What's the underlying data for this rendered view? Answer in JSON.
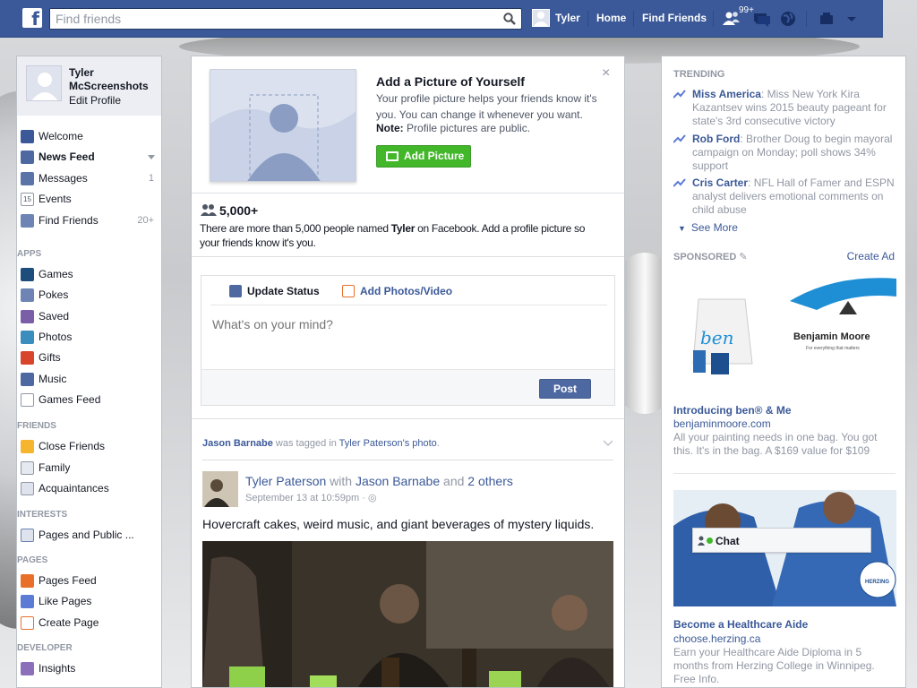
{
  "topbar": {
    "logo": "f",
    "search_placeholder": "Find friends",
    "user_name": "Tyler",
    "home": "Home",
    "find_friends": "Find Friends",
    "friend_requests_badge": "99+"
  },
  "left": {
    "profile_name": "Tyler McScreenshots",
    "edit_profile": "Edit Profile",
    "favorites": [
      {
        "label": "Welcome",
        "count": ""
      },
      {
        "label": "News Feed",
        "count": ""
      },
      {
        "label": "Messages",
        "count": "1"
      },
      {
        "label": "Events",
        "count": ""
      },
      {
        "label": "Find Friends",
        "count": "20+"
      }
    ],
    "apps_title": "APPS",
    "apps": [
      "Games",
      "Pokes",
      "Saved",
      "Photos",
      "Gifts",
      "Music",
      "Games Feed"
    ],
    "friends_title": "FRIENDS",
    "friends": [
      "Close Friends",
      "Family",
      "Acquaintances"
    ],
    "interests_title": "INTERESTS",
    "interests": [
      "Pages and Public ..."
    ],
    "pages_title": "PAGES",
    "pages": [
      "Pages Feed",
      "Like Pages",
      "Create Page"
    ],
    "developer_title": "DEVELOPER",
    "developer": [
      "Insights"
    ]
  },
  "center": {
    "add_pic_title": "Add a Picture of Yourself",
    "add_pic_text": "Your profile picture helps your friends know it's you. You can change it whenever you want.",
    "note_label": "Note:",
    "note_text": "Profile pictures are public.",
    "add_pic_button": "Add Picture",
    "close": "×",
    "people_count": "5,000+",
    "people_text_1": "There are more than 5,000 people named ",
    "people_name": "Tyler",
    "people_text_2": " on Facebook. Add a profile picture so your friends know it's you.",
    "composer": {
      "update_status": "Update Status",
      "add_photos": "Add Photos/Video",
      "placeholder": "What's on your mind?",
      "post": "Post"
    },
    "story": {
      "tagged_person": "Jason Barnabe",
      "tagged_text": " was tagged in ",
      "photo_owner": "Tyler Paterson's",
      "photo_word": "photo",
      "period": ".",
      "author": "Tyler Paterson",
      "with": " with ",
      "with_person": "Jason Barnabe",
      "and": " and ",
      "others": "2 others",
      "time": "September 13 at 10:59pm · ",
      "body": "Hovercraft cakes, weird music, and giant beverages of mystery liquids."
    }
  },
  "right": {
    "trending_title": "TRENDING",
    "trends": [
      {
        "name": "Miss America",
        "text": ": Miss New York Kira Kazantsev wins 2015 beauty pageant for state's 3rd consecutive victory"
      },
      {
        "name": "Rob Ford",
        "text": ": Brother Doug to begin mayoral campaign on Monday; poll shows 34% support"
      },
      {
        "name": "Cris Carter",
        "text": ": NFL Hall of Famer and ESPN analyst delivers emotional comments on child abuse"
      }
    ],
    "see_more": "See More",
    "sponsored_title": "SPONSORED",
    "create_ad": "Create Ad",
    "ad1": {
      "brand_text": "Benjamin Moore",
      "brand_tagline": "For everything that matters",
      "bag_text": "ben",
      "title": "Introducing ben® & Me",
      "url": "benjaminmoore.com",
      "text": "All your painting needs in one bag. You got this. It's in the bag. A $169 value for $109"
    },
    "ad2": {
      "badge_text": "HERZING",
      "title": "Become a Healthcare Aide",
      "url": "choose.herzing.ca",
      "text": "Earn your Healthcare Aide Diploma in 5 months from Herzing College in Winnipeg. Free Info."
    },
    "chat": "Chat"
  },
  "colors": {
    "brand": "#3b5998",
    "green": "#42b72a"
  }
}
